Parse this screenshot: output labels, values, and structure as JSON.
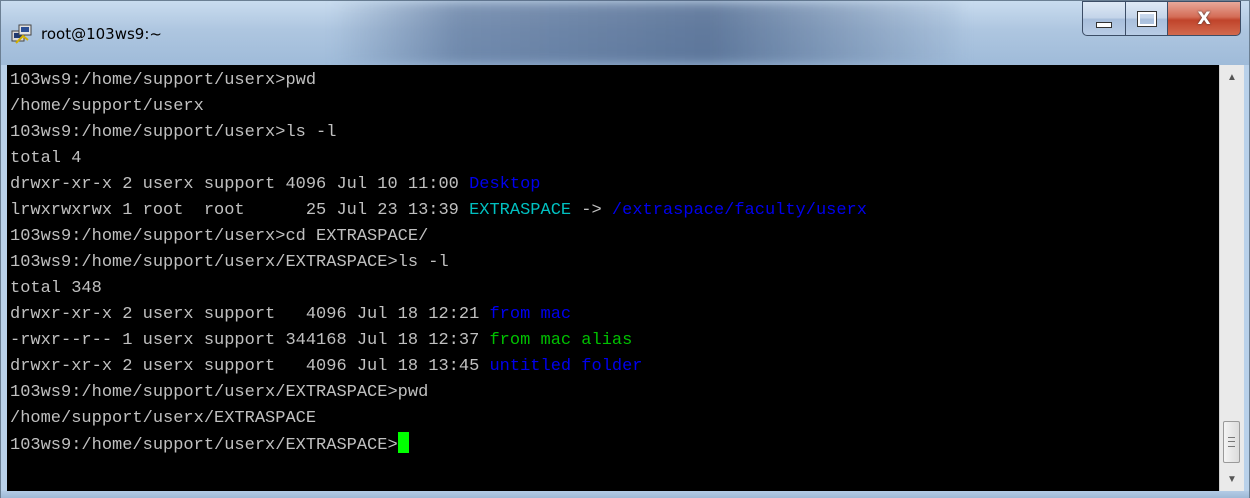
{
  "window": {
    "title": "root@103ws9:~",
    "icon": "putty-icon",
    "controls": {
      "minimize": "minimize-icon",
      "maximize": "maximize-icon",
      "close": "close-icon",
      "close_glyph": "X"
    }
  },
  "colors": {
    "terminal_bg": "#000000",
    "terminal_fg": "#c0c0c0",
    "directory": "#0000ee",
    "symlink": "#00c0c0",
    "executable": "#00c000",
    "cursor": "#00ff00"
  },
  "terminal": {
    "lines": [
      [
        {
          "text": "103ws9:/home/support/userx>pwd"
        }
      ],
      [
        {
          "text": "/home/support/userx"
        }
      ],
      [
        {
          "text": "103ws9:/home/support/userx>ls -l"
        }
      ],
      [
        {
          "text": "total 4"
        }
      ],
      [
        {
          "text": "drwxr-xr-x 2 userx support 4096 Jul 10 11:00 "
        },
        {
          "text": "Desktop",
          "style": "dir"
        }
      ],
      [
        {
          "text": "lrwxrwxrwx 1 root  root      25 Jul 23 13:39 "
        },
        {
          "text": "EXTRASPACE",
          "style": "link"
        },
        {
          "text": " -> "
        },
        {
          "text": "/extraspace/faculty/userx",
          "style": "dir"
        }
      ],
      [
        {
          "text": "103ws9:/home/support/userx>cd EXTRASPACE/"
        }
      ],
      [
        {
          "text": "103ws9:/home/support/userx/EXTRASPACE>ls -l"
        }
      ],
      [
        {
          "text": "total 348"
        }
      ],
      [
        {
          "text": "drwxr-xr-x 2 userx support   4096 Jul 18 12:21 "
        },
        {
          "text": "from mac",
          "style": "dir"
        }
      ],
      [
        {
          "text": "-rwxr--r-- 1 userx support 344168 Jul 18 12:37 "
        },
        {
          "text": "from mac alias",
          "style": "exec"
        }
      ],
      [
        {
          "text": "drwxr-xr-x 2 userx support   4096 Jul 18 13:45 "
        },
        {
          "text": "untitled folder",
          "style": "dir"
        }
      ],
      [
        {
          "text": "103ws9:/home/support/userx/EXTRASPACE>pwd"
        }
      ],
      [
        {
          "text": "/home/support/userx/EXTRASPACE"
        }
      ],
      [
        {
          "text": "103ws9:/home/support/userx/EXTRASPACE>"
        },
        {
          "cursor": true
        }
      ]
    ]
  },
  "scrollbar": {
    "up_icon": "▲",
    "down_icon": "▼",
    "position_fraction": 1.0
  }
}
